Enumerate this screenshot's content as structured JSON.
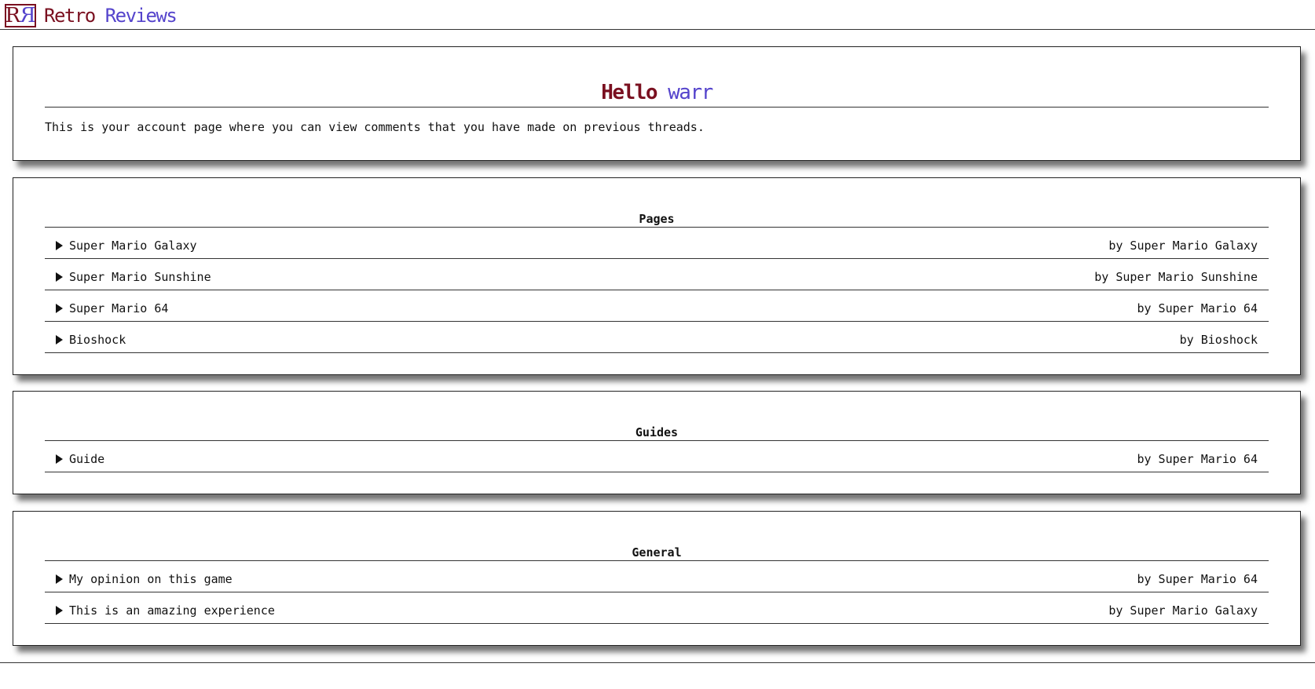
{
  "header": {
    "logo_left": "R",
    "logo_right": "R",
    "brand_part1": "Retro",
    "brand_part2": "Reviews"
  },
  "account": {
    "greeting": "Hello",
    "username": "warr",
    "intro": "This is your account page where you can view comments that you have made on previous threads."
  },
  "sections": [
    {
      "title": "Pages",
      "items": [
        {
          "title": "Super Mario Galaxy",
          "by": "by Super Mario Galaxy"
        },
        {
          "title": "Super Mario Sunshine",
          "by": "by Super Mario Sunshine"
        },
        {
          "title": "Super Mario 64",
          "by": "by Super Mario 64"
        },
        {
          "title": "Bioshock",
          "by": "by Bioshock"
        }
      ]
    },
    {
      "title": "Guides",
      "items": [
        {
          "title": "Guide",
          "by": "by Super Mario 64"
        }
      ]
    },
    {
      "title": "General",
      "items": [
        {
          "title": "My opinion on this game",
          "by": "by Super Mario 64"
        },
        {
          "title": "This is an amazing experience",
          "by": "by Super Mario Galaxy"
        }
      ]
    }
  ],
  "colors": {
    "brand_primary": "#7a1020",
    "brand_secondary": "#5544cc"
  }
}
